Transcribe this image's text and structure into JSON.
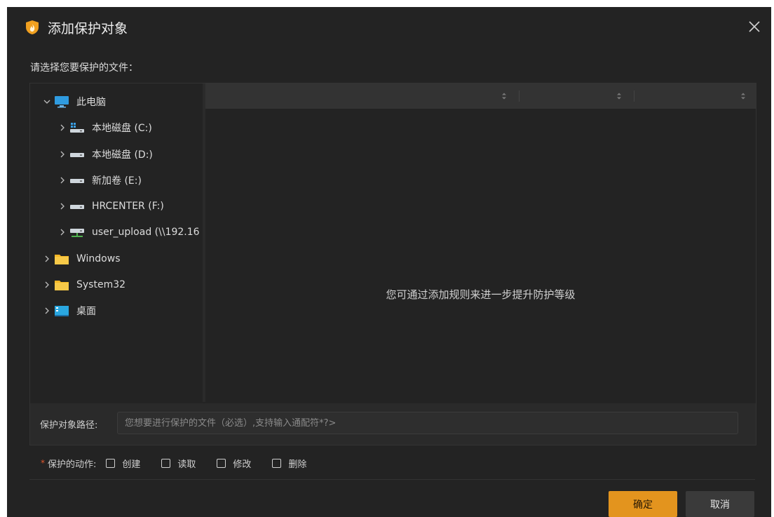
{
  "dialog": {
    "title": "添加保护对象",
    "prompt": "请选择您要保护的文件："
  },
  "tree": {
    "items": [
      {
        "label": "此电脑",
        "icon": "computer-icon",
        "expanded": true
      },
      {
        "label": "本地磁盘 (C:)",
        "icon": "system-drive-icon"
      },
      {
        "label": "本地磁盘 (D:)",
        "icon": "drive-icon"
      },
      {
        "label": "新加卷 (E:)",
        "icon": "drive-icon"
      },
      {
        "label": "HRCENTER (F:)",
        "icon": "drive-icon"
      },
      {
        "label": "user_upload (\\\\192.16",
        "icon": "network-drive-icon"
      },
      {
        "label": "Windows",
        "icon": "folder-icon"
      },
      {
        "label": "System32",
        "icon": "folder-icon"
      },
      {
        "label": "桌面",
        "icon": "desktop-icon"
      }
    ]
  },
  "grid": {
    "empty_text": "您可通过添加规则来进一步提升防护等级"
  },
  "path": {
    "label": "保护对象路径:",
    "placeholder": "您想要进行保护的文件（必选）,支持输入通配符*?>"
  },
  "actions": {
    "label": "保护的动作:",
    "required_mark": "*",
    "options": [
      "创建",
      "读取",
      "修改",
      "删除"
    ]
  },
  "buttons": {
    "ok": "确定",
    "cancel": "取消"
  },
  "colors": {
    "accent": "#e3941e",
    "background": "#232323",
    "required": "#e0582e"
  }
}
